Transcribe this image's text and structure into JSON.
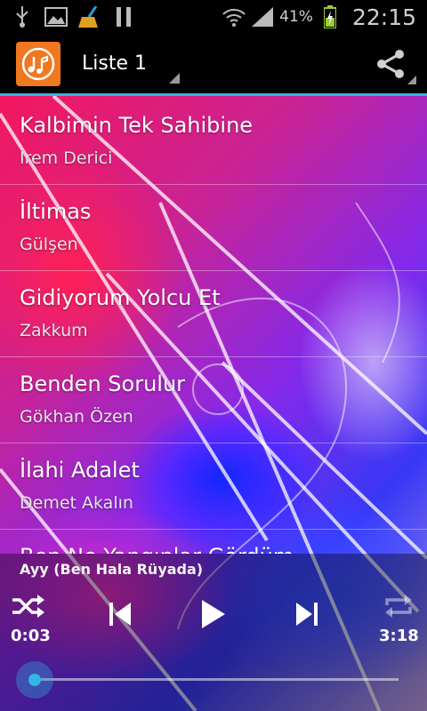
{
  "status_bar": {
    "battery_percent": "41%",
    "clock": "22:15",
    "icons": [
      "usb-icon",
      "image-icon",
      "cleaner-icon",
      "pause-icon",
      "wifi-icon",
      "signal-icon",
      "battery-charging-icon"
    ]
  },
  "action_bar": {
    "app_icon": "music-app-icon",
    "playlist_label": "Liste 1",
    "share_icon": "share-icon",
    "accent_color": "#33b5e5"
  },
  "songs": [
    {
      "title": "Kalbimin Tek Sahibine",
      "artist": "İrem Derici"
    },
    {
      "title": "İltimas",
      "artist": "Gülşen"
    },
    {
      "title": "Gidiyorum Yolcu Et",
      "artist": "Zakkum"
    },
    {
      "title": "Benden Sorulur",
      "artist": "Gökhan Özen"
    },
    {
      "title": "İlahi Adalet",
      "artist": "Demet Akalın"
    },
    {
      "title": "Ben Ne Yangınlar Gördüm",
      "artist": ""
    }
  ],
  "player": {
    "now_playing": "Ayy (Ben Hala Rüyada)",
    "elapsed": "0:03",
    "duration": "3:18",
    "progress_fraction": 0.016,
    "controls": [
      "shuffle-icon",
      "previous-icon",
      "play-icon",
      "next-icon",
      "repeat-icon"
    ]
  }
}
